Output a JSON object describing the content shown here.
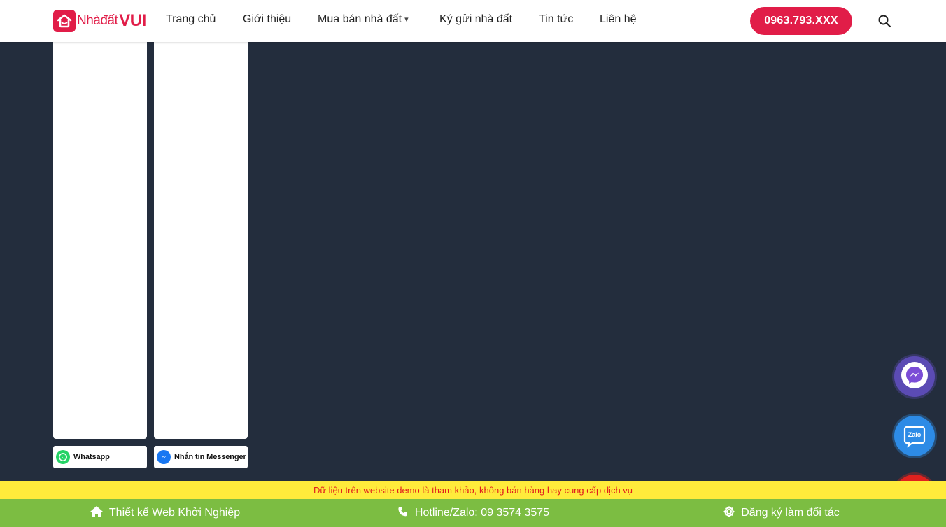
{
  "header": {
    "logo_part1": "Nhàđất",
    "logo_part2": "VUI",
    "nav": [
      {
        "label": "Trang chủ"
      },
      {
        "label": "Giới thiệu"
      },
      {
        "label": "Mua bán nhà đất",
        "has_dropdown": true
      },
      {
        "label": "Ký gửi nhà đất"
      },
      {
        "label": "Tin tức"
      },
      {
        "label": "Liên hệ"
      }
    ],
    "phone": "0963.793.XXX",
    "search_icon": "search-icon"
  },
  "cards": [
    {
      "chip_label": "Whatsapp",
      "icon": "whatsapp-icon",
      "icon_color": "#25d366"
    },
    {
      "chip_label": "Nhắn tin Messenger",
      "icon": "messenger-icon",
      "icon_color": "#1877f2"
    }
  ],
  "floating": {
    "messenger_icon": "messenger-icon",
    "zalo_label": "Zalo",
    "phone_icon": "phone-icon"
  },
  "notice": "Dữ liệu trên website demo là tham khảo, không bán hàng hay cung cấp dịch vụ",
  "bottom_bar": [
    {
      "label": "Thiết kế Web Khởi Nghiệp",
      "icon": "home-icon"
    },
    {
      "label": "Hotline/Zalo: 09 3574 3575",
      "icon": "phone-icon"
    },
    {
      "label": "Đăng ký làm đối tác",
      "icon": "gear-icon"
    }
  ],
  "colors": {
    "brand": "#e11d48",
    "background": "#232d3d",
    "bottom_bar": "#7cbd42",
    "notice_bg": "#ffeb3b",
    "notice_text": "#e11d1d"
  }
}
